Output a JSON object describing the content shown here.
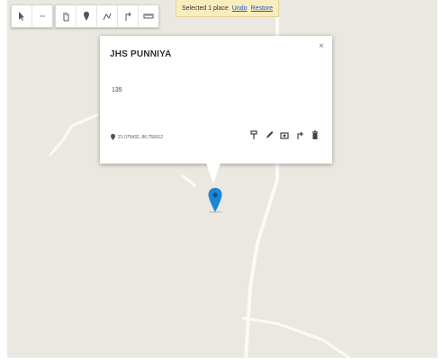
{
  "map": {
    "background": "#ebe8e1",
    "road_color": "#fbfaf7"
  },
  "toolbar": {
    "tools": [
      {
        "name": "select-tool",
        "icon": "pointer-icon"
      },
      {
        "name": "undo-tool",
        "icon": "undo-icon"
      },
      {
        "name": "pan-tool",
        "icon": "hand-icon"
      },
      {
        "name": "add-marker-tool",
        "icon": "marker-icon"
      },
      {
        "name": "draw-line-tool",
        "icon": "line-icon"
      },
      {
        "name": "directions-tool",
        "icon": "directions-icon"
      },
      {
        "name": "measure-tool",
        "icon": "ruler-icon"
      }
    ]
  },
  "selection_banner": {
    "text": "Selected 1 place",
    "links": [
      "Undo",
      "Restore"
    ]
  },
  "popup": {
    "title": "JHS PUNNIYA",
    "close": "×",
    "description": "135",
    "coords": "21.075432, 86.759012",
    "actions": [
      "paint-style-icon",
      "edit-icon",
      "camera-icon",
      "directions-icon",
      "delete-icon"
    ]
  },
  "marker": {
    "color": "#1a87d6"
  }
}
